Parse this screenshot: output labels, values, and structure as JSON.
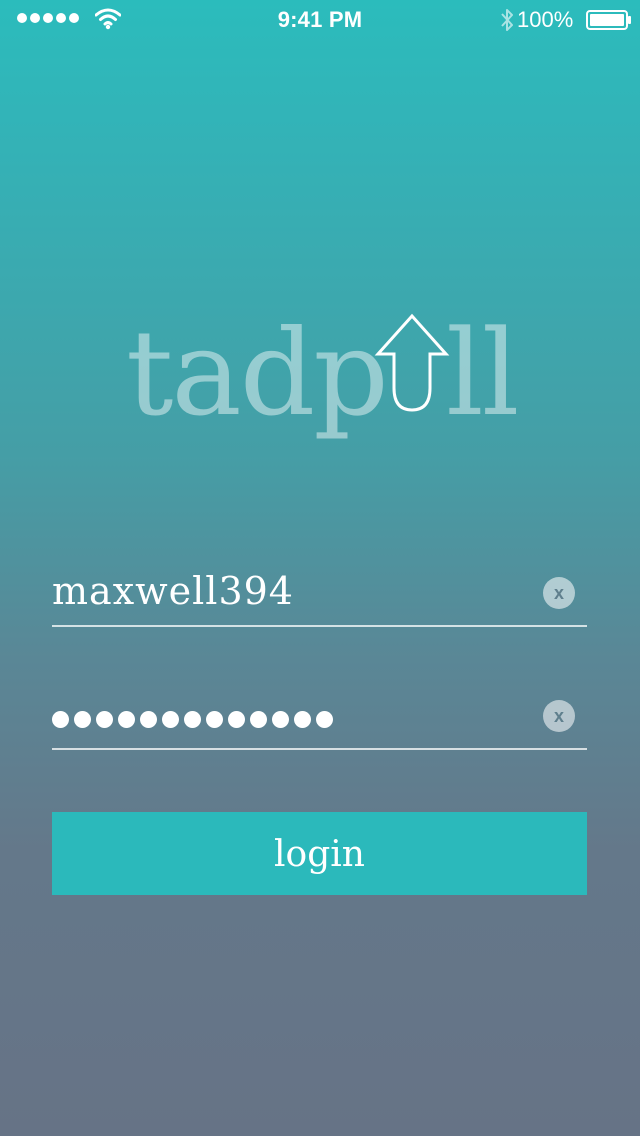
{
  "status_bar": {
    "time": "9:41 PM",
    "battery_percent": "100%",
    "signal_bars": 5,
    "icons": [
      "signal-dots",
      "wifi-icon",
      "bluetooth-icon",
      "battery-icon"
    ]
  },
  "logo": {
    "text_left": "tadp",
    "text_right": "ll",
    "icon": "up-arrow-u-icon"
  },
  "form": {
    "username": {
      "value": "maxwell394",
      "clear_label": "x"
    },
    "password": {
      "masked_length": 13,
      "clear_label": "x"
    },
    "login_label": "login"
  },
  "colors": {
    "accent": "#2bb9bb",
    "gradient_top": "#2bbcbc",
    "gradient_bottom": "#667386"
  }
}
